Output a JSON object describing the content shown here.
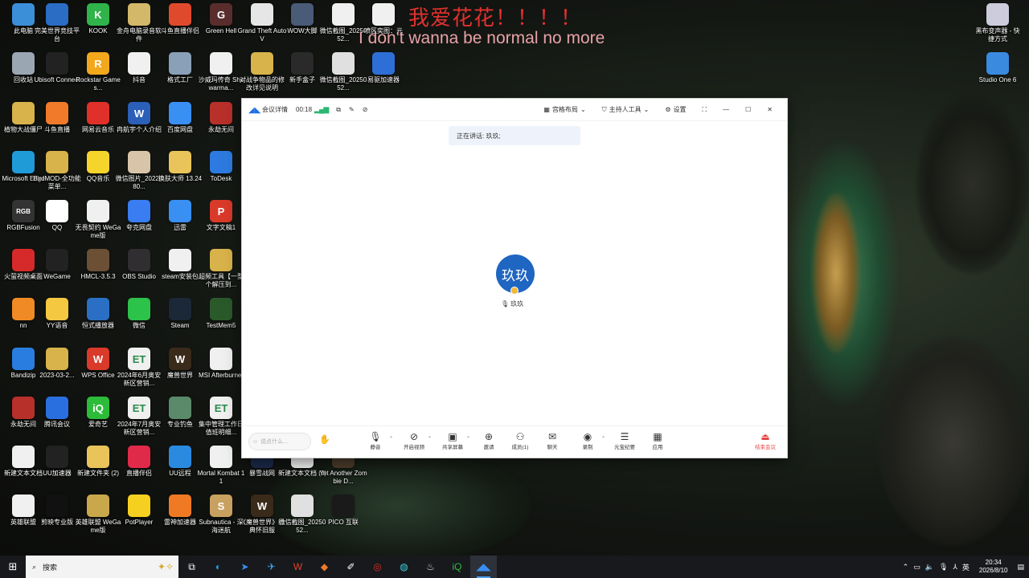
{
  "overlay": {
    "line1": "我爱花花！！！！",
    "line2": "I don't wanna be normal no more"
  },
  "desktop_icons": [
    {
      "label": "此电脑",
      "icon": "pc-icon",
      "color": "#3b8fd9"
    },
    {
      "label": "完美世界竞技平台",
      "icon": "perfect-world-icon",
      "color": "#2b6cc4"
    },
    {
      "label": "KOOK",
      "icon": "kook-icon",
      "color": "#2fb34a",
      "glyph": "K"
    },
    {
      "label": "金舟电脑录音软件",
      "icon": "recorder-icon",
      "color": "#d4b86a"
    },
    {
      "label": "斗鱼直播伴侣",
      "icon": "douyu-icon",
      "color": "#e04a2c"
    },
    {
      "label": "Green Hell",
      "icon": "green-hell-icon",
      "color": "#5a2d2d",
      "glyph": "G"
    },
    {
      "label": "Grand Theft Auto V",
      "icon": "gta-icon",
      "color": "#e6e6e6"
    },
    {
      "label": "WOW大脚",
      "icon": "wow-bigfoot-icon",
      "color": "#4a5b78"
    },
    {
      "label": "微信截图_2025052...",
      "icon": "screenshot-icon",
      "color": "#f0f0f0"
    },
    {
      "label": "喷区奕图：元",
      "icon": "document-icon",
      "color": "#f0f0f0"
    },
    {
      "label": "回收站",
      "icon": "recycle-bin-icon",
      "color": "#9aa7b3"
    },
    {
      "label": "Ubisoft Connect",
      "icon": "ubisoft-icon",
      "color": "#222"
    },
    {
      "label": "Rockstar Games...",
      "icon": "rockstar-icon",
      "color": "#f2a81d",
      "glyph": "R"
    },
    {
      "label": "抖音",
      "icon": "file-icon",
      "color": "#f0f0f0"
    },
    {
      "label": "格式工厂",
      "icon": "format-factory-icon",
      "color": "#8aa0b8"
    },
    {
      "label": "沙威玛传奇 Shawarma...",
      "icon": "file-icon",
      "color": "#f0f0f0"
    },
    {
      "label": "对战争物品的修改详见说明",
      "icon": "folder-zip-icon",
      "color": "#d8b24a"
    },
    {
      "label": "新手盒子",
      "icon": "game-box-icon",
      "color": "#2a2a2a"
    },
    {
      "label": "微信截图_2025052...",
      "icon": "screenshot-icon",
      "color": "#e0e0e0"
    },
    {
      "label": "易驱加速器",
      "icon": "accelerator-icon",
      "color": "#2d6fd6"
    },
    {
      "label": "植物大战僵尸",
      "icon": "pvz-icon",
      "color": "#d8b24a"
    },
    {
      "label": "斗鱼直播",
      "icon": "douyu-live-icon",
      "color": "#f07a2a"
    },
    {
      "label": "网易云音乐",
      "icon": "netease-music-icon",
      "color": "#e0302a"
    },
    {
      "label": "冉航宇个人介绍",
      "icon": "word-doc-icon",
      "color": "#2b5fb8",
      "glyph": "W"
    },
    {
      "label": "百度网盘",
      "icon": "baidu-netdisk-icon",
      "color": "#3a8ff2"
    },
    {
      "label": "永劫无间",
      "icon": "naraka-icon",
      "color": "#b8302a"
    },
    {
      "label": "Microsoft Edge",
      "icon": "edge-icon",
      "color": "#1f9bd8"
    },
    {
      "label": "BirdMOD-全功能菜单...",
      "icon": "folder-zip-icon",
      "color": "#d8b24a"
    },
    {
      "label": "QQ音乐",
      "icon": "qq-music-icon",
      "color": "#f5d42c"
    },
    {
      "label": "微信图片_2022080...",
      "icon": "image-icon",
      "color": "#d8c4a8"
    },
    {
      "label": "换肤大师 13.24",
      "icon": "folder-icon",
      "color": "#e8c45a"
    },
    {
      "label": "ToDesk",
      "icon": "todesk-icon",
      "color": "#2d7be0"
    },
    {
      "label": "RGBFusion",
      "icon": "rgbfusion-icon",
      "color": "#333",
      "glyph": "RGB"
    },
    {
      "label": "QQ",
      "icon": "qq-icon",
      "color": "#fff"
    },
    {
      "label": "无畏契约 WeGame版",
      "icon": "file-icon",
      "color": "#f0f0f0"
    },
    {
      "label": "夸克网盘",
      "icon": "quark-icon",
      "color": "#3a7cf2"
    },
    {
      "label": "迅雷",
      "icon": "thunder-icon",
      "color": "#3a8ff2"
    },
    {
      "label": "文字文稿1",
      "icon": "wps-doc-icon",
      "color": "#d93a2a",
      "glyph": "P"
    },
    {
      "label": "火萤视频桌面",
      "icon": "firefly-icon",
      "color": "#d62a2a"
    },
    {
      "label": "WeGame",
      "icon": "wegame-icon",
      "color": "#222"
    },
    {
      "label": "HMCL-3.5.3",
      "icon": "hmcl-icon",
      "color": "#6b5036"
    },
    {
      "label": "OBS Studio",
      "icon": "obs-icon",
      "color": "#302e31"
    },
    {
      "label": "steam安装包",
      "icon": "file-icon",
      "color": "#f0f0f0"
    },
    {
      "label": "超频工具【一整个解压到...",
      "icon": "folder-zip-icon",
      "color": "#d8b24a"
    },
    {
      "label": "nn",
      "icon": "nn-icon",
      "color": "#f08a24"
    },
    {
      "label": "YY语音",
      "icon": "yy-icon",
      "color": "#f5c842"
    },
    {
      "label": "恒式播放器",
      "icon": "player-icon",
      "color": "#2a6fc4"
    },
    {
      "label": "微信",
      "icon": "wechat-icon",
      "color": "#2dc24a"
    },
    {
      "label": "Steam",
      "icon": "steam-icon",
      "color": "#1b2838"
    },
    {
      "label": "TestMem5",
      "icon": "testmem-icon",
      "color": "#2a5a2a"
    },
    {
      "label": "Bandizip",
      "icon": "bandizip-icon",
      "color": "#2a7de0"
    },
    {
      "label": "2023-03-2...",
      "icon": "folder-zip-icon",
      "color": "#d8b24a"
    },
    {
      "label": "WPS Office",
      "icon": "wps-icon",
      "color": "#d93a2a",
      "glyph": "W"
    },
    {
      "label": "2024年6月奥安新区营销...",
      "icon": "excel-file-icon",
      "color": "#f0f0f0",
      "glyph": "ET"
    },
    {
      "label": "魔兽世界",
      "icon": "wow-icon",
      "color": "#3a2a1a",
      "glyph": "W"
    },
    {
      "label": "MSI Afterburner",
      "icon": "file-icon",
      "color": "#f0f0f0"
    },
    {
      "label": "永劫无间",
      "icon": "naraka-icon",
      "color": "#b8302a"
    },
    {
      "label": "腾讯会议",
      "icon": "tencent-meeting-icon",
      "color": "#2a6fe0"
    },
    {
      "label": "爱奇艺",
      "icon": "iqiyi-icon",
      "color": "#2dbb3a",
      "glyph": "iQ"
    },
    {
      "label": "2024年7月奥安新区营销...",
      "icon": "excel-file-icon",
      "color": "#f0f0f0",
      "glyph": "ET"
    },
    {
      "label": "专业钓鱼",
      "icon": "fishing-icon",
      "color": "#5a8a6a"
    },
    {
      "label": "集中管理工作日值班明细...",
      "icon": "excel-file-icon",
      "color": "#f0f0f0",
      "glyph": "ET"
    },
    {
      "label": "新建文本文档",
      "icon": "text-file-icon",
      "color": "#f0f0f0"
    },
    {
      "label": "UU加速器",
      "icon": "uu-icon",
      "color": "#222"
    },
    {
      "label": "新建文件夹 (2)",
      "icon": "folder-icon",
      "color": "#e8c45a"
    },
    {
      "label": "直播伴侣",
      "icon": "live-assistant-icon",
      "color": "#e02a4a"
    },
    {
      "label": "UU远程",
      "icon": "uu-remote-icon",
      "color": "#2a8ae0"
    },
    {
      "label": "Mortal Kombat 11",
      "icon": "file-icon",
      "color": "#f0f0f0"
    },
    {
      "label": "暴雪战网",
      "icon": "battlenet-icon",
      "color": "#1a2a4a"
    },
    {
      "label": "新建文本文档 (2)",
      "icon": "text-file-icon",
      "color": "#f0f0f0"
    },
    {
      "label": "Yet Another Zombie D...",
      "icon": "zombie-game-icon",
      "color": "#4a3a2a"
    },
    {
      "label": "英雄联盟",
      "icon": "file-icon",
      "color": "#f0f0f0"
    },
    {
      "label": "剪映专业版",
      "icon": "capcut-icon",
      "color": "#111"
    },
    {
      "label": "英雄联盟 WeGame版",
      "icon": "lol-icon",
      "color": "#c8a84a"
    },
    {
      "label": "PotPlayer",
      "icon": "potplayer-icon",
      "color": "#f5d020"
    },
    {
      "label": "雷神加速器",
      "icon": "leishen-icon",
      "color": "#f07a24"
    },
    {
      "label": "Subnautica - 深海迷航",
      "icon": "subnautica-icon",
      "color": "#c8a060",
      "glyph": "S"
    },
    {
      "label": "《魔兽世界》经典怀旧服",
      "icon": "wow-classic-icon",
      "color": "#3a2a1a",
      "glyph": "W"
    },
    {
      "label": "微信截图_2025052...",
      "icon": "screenshot-icon",
      "color": "#e0e0e0"
    },
    {
      "label": "PICO 互联",
      "icon": "pico-icon",
      "color": "#1a1a1a"
    },
    {
      "label": "黑布变声器 - 快捷方式",
      "icon": "voice-changer-icon",
      "color": "#ccd"
    },
    {
      "label": "Studio One 6",
      "icon": "studio-one-icon",
      "color": "#3a8ae0"
    }
  ],
  "meeting": {
    "details_label": "会议详情",
    "timer": "00:18",
    "layout_label": "宫格布局",
    "host_tools_label": "主持人工具",
    "settings_label": "设置",
    "speaking_text": "正在讲话: 玖玖;",
    "participant_avatar_text": "玖玖",
    "participant_name": "玖玖",
    "chat_placeholder": "说点什么...",
    "toolbar": [
      {
        "label": "静音",
        "icon": "microphone-icon",
        "caret": true
      },
      {
        "label": "开启视频",
        "icon": "video-off-icon",
        "caret": true
      },
      {
        "label": "共享屏幕",
        "icon": "share-screen-icon",
        "caret": true
      },
      {
        "label": "邀请",
        "icon": "invite-icon",
        "caret": false
      },
      {
        "label": "成员(1)",
        "icon": "members-icon",
        "caret": false
      },
      {
        "label": "聊天",
        "icon": "chat-icon",
        "caret": false
      },
      {
        "label": "录制",
        "icon": "record-icon",
        "caret": true
      },
      {
        "label": "元宝纪要",
        "icon": "minutes-icon",
        "caret": false
      },
      {
        "label": "应用",
        "icon": "apps-icon",
        "caret": false
      },
      {
        "label": "结束会议",
        "icon": "end-meeting-icon",
        "caret": false
      }
    ]
  },
  "taskbar": {
    "search_placeholder": "搜索",
    "apps": [
      "task-view-icon",
      "edge-icon",
      "thunder-icon",
      "feishu-icon",
      "wps-icon",
      "douyu-icon",
      "edit-icon",
      "netease-music-icon",
      "uu-icon",
      "steam-icon",
      "iqiyi-icon",
      "tencent-meeting-icon"
    ],
    "tray_lang": "英",
    "time": "20:34",
    "date": "2026/8/10"
  }
}
